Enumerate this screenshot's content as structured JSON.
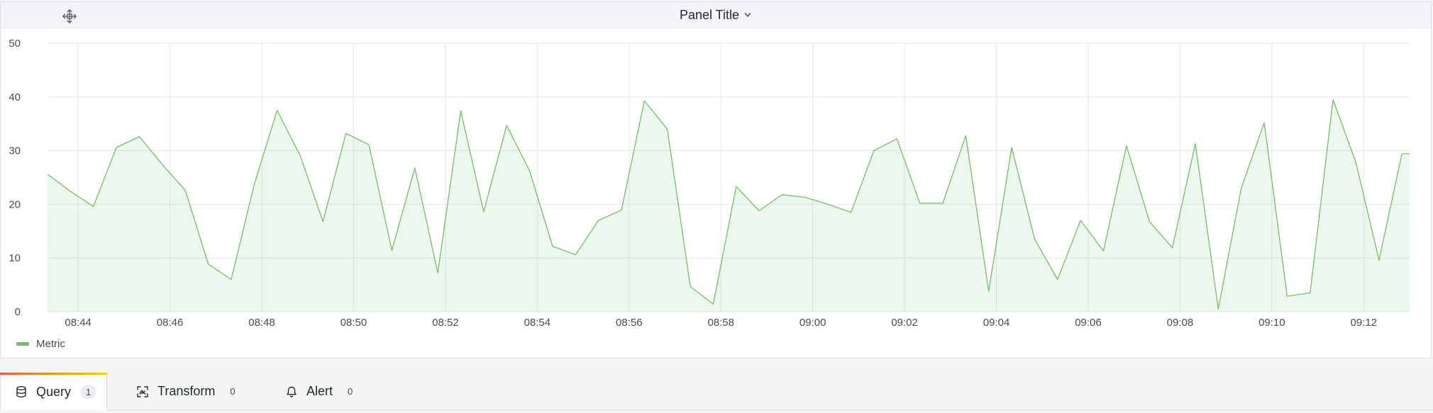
{
  "panel": {
    "title": "Panel Title"
  },
  "colors": {
    "series": "#73bf69",
    "fill": "rgba(115,191,105,0.12)",
    "grid": "#e6e7e9",
    "accent_start": "#f05a28",
    "accent_end": "#fbca0a"
  },
  "chart_data": {
    "type": "area",
    "title": "Panel Title",
    "y_ticks": [
      "50",
      "40",
      "30",
      "20",
      "10",
      "0"
    ],
    "x_ticks": [
      "08:44",
      "08:46",
      "08:48",
      "08:50",
      "08:52",
      "08:54",
      "08:56",
      "08:58",
      "09:00",
      "09:02",
      "09:04",
      "09:06",
      "09:08",
      "09:10",
      "09:12"
    ],
    "x_range": [
      "08:43:20",
      "09:13:00"
    ],
    "ylim": [
      0,
      50
    ],
    "grid": true,
    "legend": "bottom-left",
    "series": [
      {
        "name": "Metric",
        "x": [
          "08:43:20",
          "08:43:50",
          "08:44:20",
          "08:44:50",
          "08:45:20",
          "08:45:50",
          "08:46:20",
          "08:46:50",
          "08:47:20",
          "08:47:50",
          "08:48:20",
          "08:48:50",
          "08:49:20",
          "08:49:50",
          "08:50:20",
          "08:50:50",
          "08:51:20",
          "08:51:50",
          "08:52:20",
          "08:52:50",
          "08:53:20",
          "08:53:50",
          "08:54:20",
          "08:54:50",
          "08:55:20",
          "08:55:50",
          "08:56:20",
          "08:56:50",
          "08:57:20",
          "08:57:50",
          "08:58:20",
          "08:58:50",
          "08:59:20",
          "08:59:50",
          "09:00:20",
          "09:00:50",
          "09:01:20",
          "09:01:50",
          "09:02:20",
          "09:02:50",
          "09:03:20",
          "09:03:50",
          "09:04:20",
          "09:04:50",
          "09:05:20",
          "09:05:50",
          "09:06:20",
          "09:06:50",
          "09:07:20",
          "09:07:50",
          "09:08:20",
          "09:08:50",
          "09:09:20",
          "09:09:50",
          "09:10:20",
          "09:10:50",
          "09:11:20",
          "09:11:50",
          "09:12:20",
          "09:12:50",
          "09:13:00"
        ],
        "values": [
          25.6,
          22.4,
          19.6,
          30.6,
          32.6,
          27.4,
          22.6,
          8.9,
          6.0,
          23.6,
          37.5,
          29.1,
          16.8,
          33.2,
          31.1,
          11.4,
          26.8,
          7.2,
          37.4,
          18.6,
          34.7,
          26.2,
          12.2,
          10.6,
          17.0,
          18.9,
          39.3,
          34.0,
          4.7,
          1.4,
          23.3,
          18.8,
          21.8,
          21.3,
          20.0,
          18.5,
          30.0,
          32.2,
          20.2,
          20.2,
          32.8,
          3.8,
          30.6,
          13.5,
          6.0,
          17.0,
          11.3,
          30.9,
          16.8,
          11.9,
          31.3,
          0.5,
          23.0,
          35.2,
          2.9,
          3.5,
          39.5,
          27.7,
          9.6,
          29.4,
          29.4
        ]
      }
    ]
  },
  "tabs": [
    {
      "label": "Query",
      "count": "1"
    },
    {
      "label": "Transform",
      "count": "0"
    },
    {
      "label": "Alert",
      "count": "0"
    }
  ]
}
